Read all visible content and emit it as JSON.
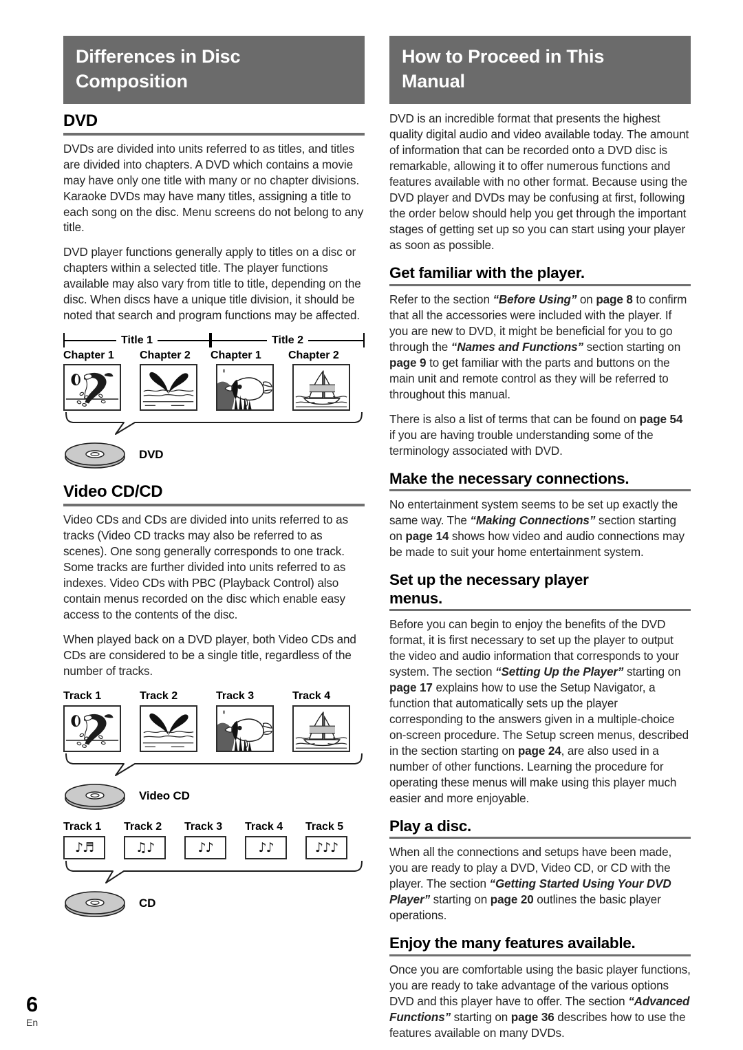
{
  "left_column": {
    "banner": {
      "line1": "Differences in Disc",
      "line2": "Composition"
    },
    "dvd_section": {
      "heading": "DVD",
      "paragraphs": [
        "DVDs are divided into units referred to as titles, and titles are divided into chapters. A DVD which contains a movie may have only one title with many or no chapter divisions. Karaoke DVDs may have many titles, assigning a title to each song on the disc. Menu screens do not belong to any title.",
        "DVD player functions generally apply to titles on a disc or chapters within a selected title. The player functions available may also vary from title to title, depending on the disc. When discs have a unique title division, it should be noted that search and program functions may be affected."
      ],
      "figure": {
        "titles": [
          "Title 1",
          "Title 2"
        ],
        "chapters": [
          "Chapter 1",
          "Chapter 2",
          "Chapter 1",
          "Chapter 2"
        ],
        "scenes": [
          "dolphin",
          "whale-tail",
          "fish",
          "sailboat"
        ],
        "disc_label": "DVD"
      }
    },
    "videocd_section": {
      "heading": "Video CD/CD",
      "paragraphs": [
        "Video CDs and CDs are divided into units referred to as tracks (Video CD tracks may also be referred to as scenes). One song generally corresponds to one track. Some tracks are further divided into units referred to as indexes. Video CDs with PBC (Playback Control) also contain menus recorded on the disc which enable easy access to the contents of the disc.",
        "When played back on a DVD player, both Video CDs and CDs are considered to be a single title, regardless of the number of tracks."
      ],
      "videocd_figure": {
        "tracks": [
          "Track 1",
          "Track 2",
          "Track 3",
          "Track 4"
        ],
        "scenes": [
          "dolphin",
          "whale-tail",
          "fish",
          "sailboat"
        ],
        "disc_label": "Video CD"
      },
      "cd_figure": {
        "tracks": [
          "Track 1",
          "Track 2",
          "Track 3",
          "Track 4",
          "Track 5"
        ],
        "notes": [
          "♪♬",
          "♫♪",
          "♪♪",
          "♪♪",
          "♪♪♪"
        ],
        "disc_label": "CD"
      }
    }
  },
  "right_column": {
    "banner": {
      "line1": "How to Proceed in This",
      "line2": "Manual"
    },
    "intro": "DVD is an incredible format that presents the highest quality digital audio and video available today. The amount of information that can be recorded onto a DVD disc is remarkable, allowing it to offer numerous functions and features available with no other format. Because using the DVD player and DVDs may be confusing at first, following the order below should help you get through the important stages of getting set up so you can start using your player as soon as possible.",
    "steps": [
      {
        "heading": "Get familiar with the player.",
        "para1_a": "Refer to the section ",
        "para1_it1": "“Before Using”",
        "para1_b": " on ",
        "para1_bd1": "page 8",
        "para1_c": " to confirm that all the accessories were included with the player. If you are new to DVD, it might be beneficial for you to go through the ",
        "para1_it2": "“Names and Functions”",
        "para1_d": " section starting on ",
        "para1_bd2": "page 9",
        "para1_e": " to get familiar with the parts and buttons on the main unit and remote control as they will be referred to throughout this manual.",
        "para2_a": "There is also a list of terms that can be found on ",
        "para2_bd": "page 54",
        "para2_b": " if you are having trouble understanding some of the terminology associated with DVD."
      },
      {
        "heading": "Make the necessary connections.",
        "para1_a": "No entertainment system seems to be set up exactly the same way. The ",
        "para1_it1": "“Making Connections”",
        "para1_b": " section starting on ",
        "para1_bd1": "page 14",
        "para1_c": " shows how video and audio connections may be made to suit your home entertainment system."
      },
      {
        "heading_l1": "Set up the necessary player",
        "heading_l2": "menus.",
        "para1_a": "Before you can begin to enjoy the benefits of the DVD format, it is first necessary to set up the player to output the video and audio information that corresponds to your system. The section ",
        "para1_it1": "“Setting Up the Player”",
        "para1_b": " starting on ",
        "para1_bd1": "page 17",
        "para1_c": " explains how to use the Setup Navigator, a function that automatically sets up the player corresponding to the answers given in a multiple-choice on-screen procedure. The Setup screen menus, described in the section starting on ",
        "para1_bd2": "page 24",
        "para1_d": ", are also used in a number of other functions. Learning the procedure for operating these menus will make using this player much easier and more enjoyable."
      },
      {
        "heading": "Play a disc.",
        "para1_a": "When all the connections and setups have been made, you are ready to play a DVD, Video CD, or CD with the player. The section ",
        "para1_it1": "“Getting Started Using Your DVD Player”",
        "para1_b": " starting on ",
        "para1_bd1": "page 20",
        "para1_c": " outlines the basic player operations."
      },
      {
        "heading": "Enjoy the many features available.",
        "para1_a": "Once you are comfortable using the basic player functions, you are ready to take advantage of the various options DVD and this player have to offer. The section ",
        "para1_it1": "“Advanced Functions”",
        "para1_b": " starting on ",
        "para1_bd1": "page 36",
        "para1_c": " describes how to use the features available on many DVDs."
      }
    ]
  },
  "footer": {
    "page_number": "6",
    "language": "En"
  },
  "colors": {
    "banner_bg": "#6b6b6b",
    "rule": "#6f6f6f",
    "text": "#232323",
    "disc_fill": "#c9c9c9"
  }
}
